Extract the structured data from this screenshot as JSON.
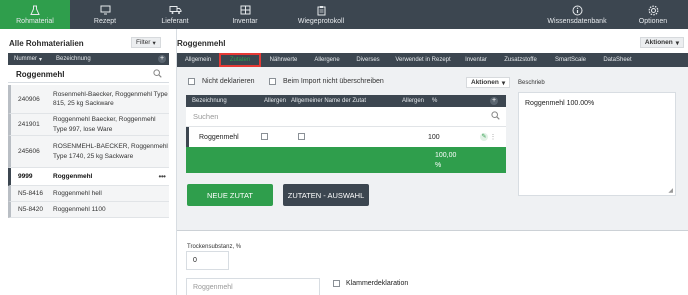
{
  "nav": {
    "items": [
      {
        "label": "Rohmaterial",
        "icon": "flask-icon",
        "active": true
      },
      {
        "label": "Rezept",
        "icon": "monitor-icon",
        "active": false
      },
      {
        "label": "Lieferant",
        "icon": "truck-icon",
        "active": false
      },
      {
        "label": "Inventar",
        "icon": "grid-icon",
        "active": false
      },
      {
        "label": "Wiegeprotokoll",
        "icon": "clipboard-icon",
        "active": false
      }
    ],
    "wissen": {
      "label": "Wissensdatenbank",
      "icon": "info-icon"
    },
    "optionen": {
      "label": "Optionen",
      "icon": "gear-icon"
    }
  },
  "left": {
    "title": "Alle Rohmaterialien",
    "filter_label": "Filter",
    "col_number": "Nummer",
    "col_bezeichnung": "Bezeichnung",
    "search_value": "Roggenmehl",
    "rows": [
      {
        "num": "240906",
        "name": "Rosenmehl-Baecker, Roggenmehl Type 815, 25 kg Sackware",
        "selected": false
      },
      {
        "num": "241901",
        "name": "Roggenmehl Baecker, Roggenmehl Type 997, lose Ware",
        "selected": false
      },
      {
        "num": "245606",
        "name": "ROSENMEHL-BAECKER, Roggenmehl Type 1740, 25 kg Sackware",
        "selected": false
      },
      {
        "num": "9999",
        "name": "Roggenmehl",
        "selected": true
      },
      {
        "num": "N5-8416",
        "name": "Roggenmehl hell",
        "selected": false
      },
      {
        "num": "N5-8420",
        "name": "Roggenmehl 1100",
        "selected": false
      }
    ]
  },
  "right": {
    "title": "Roggenmehl",
    "aktionen_label": "Aktionen",
    "tabs": [
      {
        "label": "Allgemein",
        "active": false
      },
      {
        "label": "Zutaten",
        "active": true
      },
      {
        "label": "Nährwerte",
        "active": false
      },
      {
        "label": "Allergene",
        "active": false
      },
      {
        "label": "Diverses",
        "active": false
      },
      {
        "label": "Verwendet in Rezept",
        "active": false
      },
      {
        "label": "Inventar",
        "active": false
      },
      {
        "label": "Zusatzstoffe",
        "active": false
      },
      {
        "label": "SmartScale",
        "active": false
      },
      {
        "label": "DataSheet",
        "active": false
      }
    ],
    "nicht_deklarieren": "Nicht deklarieren",
    "import_label": "Beim Import nicht überschreiben",
    "aktionen_inner": "Aktionen",
    "beschrieb_label": "Beschrieb",
    "beschrieb_text": "Roggenmehl 100.00%",
    "table": {
      "headers": [
        "Bezeichnung",
        "Allergen",
        "Allgemeiner Name der Zutat",
        "Allergen",
        "%"
      ],
      "search_placeholder": "Suchen",
      "row": {
        "name": "Roggenmehl",
        "percent": "100"
      },
      "total_1": "100,00",
      "total_2": "%"
    },
    "btn_neue": "NEUE ZUTAT",
    "btn_auswahl": "ZUTATEN - AUSWAHL",
    "trocken_label": "Trockensubstanz, %",
    "trocken_value": "0",
    "name_field": "Roggenmehl",
    "klammer_label": "Klammerdeklaration"
  }
}
